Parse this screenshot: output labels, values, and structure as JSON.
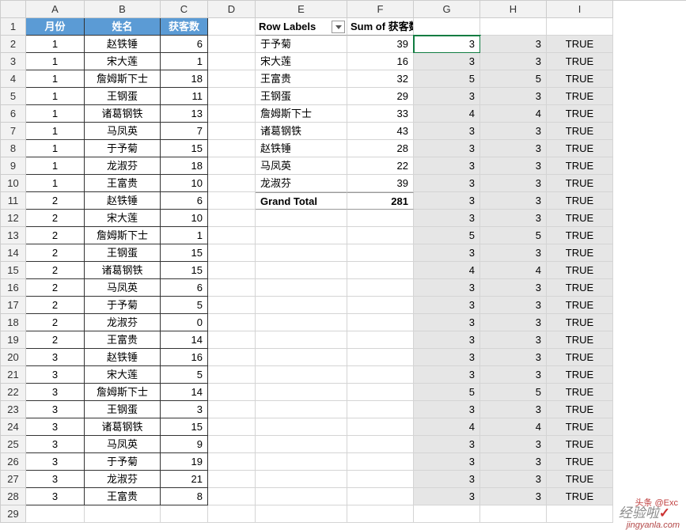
{
  "columns": [
    "A",
    "B",
    "C",
    "D",
    "E",
    "F",
    "G",
    "H",
    "I"
  ],
  "table_headers": {
    "a": "月份",
    "b": "姓名",
    "c": "获客数"
  },
  "table_rows": [
    {
      "m": "1",
      "n": "赵铁锤",
      "v": "6"
    },
    {
      "m": "1",
      "n": "宋大莲",
      "v": "1"
    },
    {
      "m": "1",
      "n": "詹姆斯下士",
      "v": "18"
    },
    {
      "m": "1",
      "n": "王钢蛋",
      "v": "11"
    },
    {
      "m": "1",
      "n": "诸葛钢铁",
      "v": "13"
    },
    {
      "m": "1",
      "n": "马凤英",
      "v": "7"
    },
    {
      "m": "1",
      "n": "于予菊",
      "v": "15"
    },
    {
      "m": "1",
      "n": "龙淑芬",
      "v": "18"
    },
    {
      "m": "1",
      "n": "王富贵",
      "v": "10"
    },
    {
      "m": "2",
      "n": "赵铁锤",
      "v": "6"
    },
    {
      "m": "2",
      "n": "宋大莲",
      "v": "10"
    },
    {
      "m": "2",
      "n": "詹姆斯下士",
      "v": "1"
    },
    {
      "m": "2",
      "n": "王钢蛋",
      "v": "15"
    },
    {
      "m": "2",
      "n": "诸葛钢铁",
      "v": "15"
    },
    {
      "m": "2",
      "n": "马凤英",
      "v": "6"
    },
    {
      "m": "2",
      "n": "于予菊",
      "v": "5"
    },
    {
      "m": "2",
      "n": "龙淑芬",
      "v": "0"
    },
    {
      "m": "2",
      "n": "王富贵",
      "v": "14"
    },
    {
      "m": "3",
      "n": "赵铁锤",
      "v": "16"
    },
    {
      "m": "3",
      "n": "宋大莲",
      "v": "5"
    },
    {
      "m": "3",
      "n": "詹姆斯下士",
      "v": "14"
    },
    {
      "m": "3",
      "n": "王钢蛋",
      "v": "3"
    },
    {
      "m": "3",
      "n": "诸葛钢铁",
      "v": "15"
    },
    {
      "m": "3",
      "n": "马凤英",
      "v": "9"
    },
    {
      "m": "3",
      "n": "于予菊",
      "v": "19"
    },
    {
      "m": "3",
      "n": "龙淑芬",
      "v": "21"
    },
    {
      "m": "3",
      "n": "王富贵",
      "v": "8"
    }
  ],
  "pivot": {
    "row_labels_hdr": "Row Labels",
    "sum_hdr": "Sum of 获客数",
    "rows": [
      {
        "label": "于予菊",
        "sum": "39"
      },
      {
        "label": "宋大莲",
        "sum": "16"
      },
      {
        "label": "王富贵",
        "sum": "32"
      },
      {
        "label": "王钢蛋",
        "sum": "29"
      },
      {
        "label": "詹姆斯下士",
        "sum": "33"
      },
      {
        "label": "诸葛钢铁",
        "sum": "43"
      },
      {
        "label": "赵铁锤",
        "sum": "28"
      },
      {
        "label": "马凤英",
        "sum": "22"
      },
      {
        "label": "龙淑芬",
        "sum": "39"
      }
    ],
    "grand_total_label": "Grand Total",
    "grand_total_value": "281"
  },
  "selection_rows": [
    {
      "g": "3",
      "h": "3",
      "i": "TRUE"
    },
    {
      "g": "3",
      "h": "3",
      "i": "TRUE"
    },
    {
      "g": "5",
      "h": "5",
      "i": "TRUE"
    },
    {
      "g": "3",
      "h": "3",
      "i": "TRUE"
    },
    {
      "g": "4",
      "h": "4",
      "i": "TRUE"
    },
    {
      "g": "3",
      "h": "3",
      "i": "TRUE"
    },
    {
      "g": "3",
      "h": "3",
      "i": "TRUE"
    },
    {
      "g": "3",
      "h": "3",
      "i": "TRUE"
    },
    {
      "g": "3",
      "h": "3",
      "i": "TRUE"
    },
    {
      "g": "3",
      "h": "3",
      "i": "TRUE"
    },
    {
      "g": "3",
      "h": "3",
      "i": "TRUE"
    },
    {
      "g": "5",
      "h": "5",
      "i": "TRUE"
    },
    {
      "g": "3",
      "h": "3",
      "i": "TRUE"
    },
    {
      "g": "4",
      "h": "4",
      "i": "TRUE"
    },
    {
      "g": "3",
      "h": "3",
      "i": "TRUE"
    },
    {
      "g": "3",
      "h": "3",
      "i": "TRUE"
    },
    {
      "g": "3",
      "h": "3",
      "i": "TRUE"
    },
    {
      "g": "3",
      "h": "3",
      "i": "TRUE"
    },
    {
      "g": "3",
      "h": "3",
      "i": "TRUE"
    },
    {
      "g": "3",
      "h": "3",
      "i": "TRUE"
    },
    {
      "g": "5",
      "h": "5",
      "i": "TRUE"
    },
    {
      "g": "3",
      "h": "3",
      "i": "TRUE"
    },
    {
      "g": "4",
      "h": "4",
      "i": "TRUE"
    },
    {
      "g": "3",
      "h": "3",
      "i": "TRUE"
    },
    {
      "g": "3",
      "h": "3",
      "i": "TRUE"
    },
    {
      "g": "3",
      "h": "3",
      "i": "TRUE"
    },
    {
      "g": "3",
      "h": "3",
      "i": "TRUE"
    }
  ],
  "watermark_top": "头条 @Exc",
  "watermark_mid": "经验啦",
  "watermark_bottom": "jingyanla.com"
}
